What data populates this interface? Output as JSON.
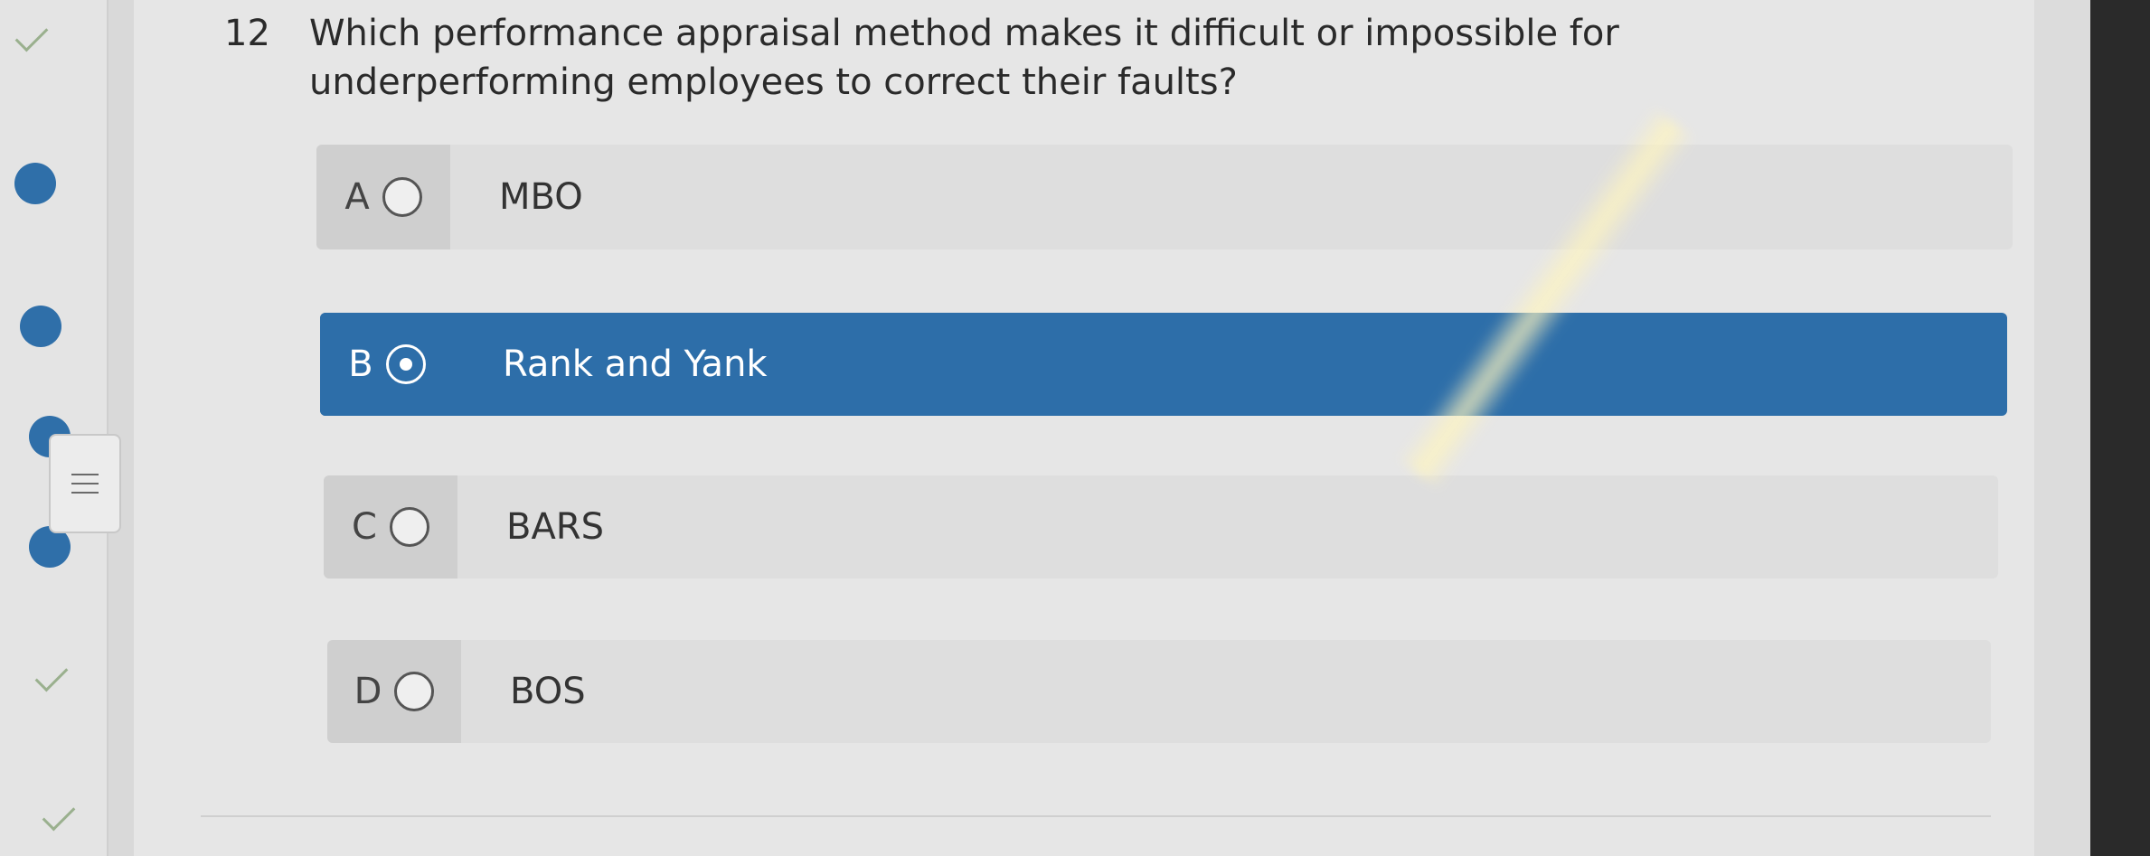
{
  "question": {
    "number": "12",
    "text": "Which performance appraisal method makes it difficult or impossible for underperforming employees to correct their faults?"
  },
  "options": [
    {
      "key": "A",
      "label": "MBO",
      "selected": false
    },
    {
      "key": "B",
      "label": "Rank and Yank",
      "selected": true
    },
    {
      "key": "C",
      "label": "BARS",
      "selected": false
    },
    {
      "key": "D",
      "label": "BOS",
      "selected": false
    }
  ],
  "colors": {
    "selected": "#2d6ea9",
    "nav_dot": "#2f6fa9",
    "check": "#9ab08e"
  },
  "nav": {
    "menu_icon": "hamburger-icon"
  }
}
